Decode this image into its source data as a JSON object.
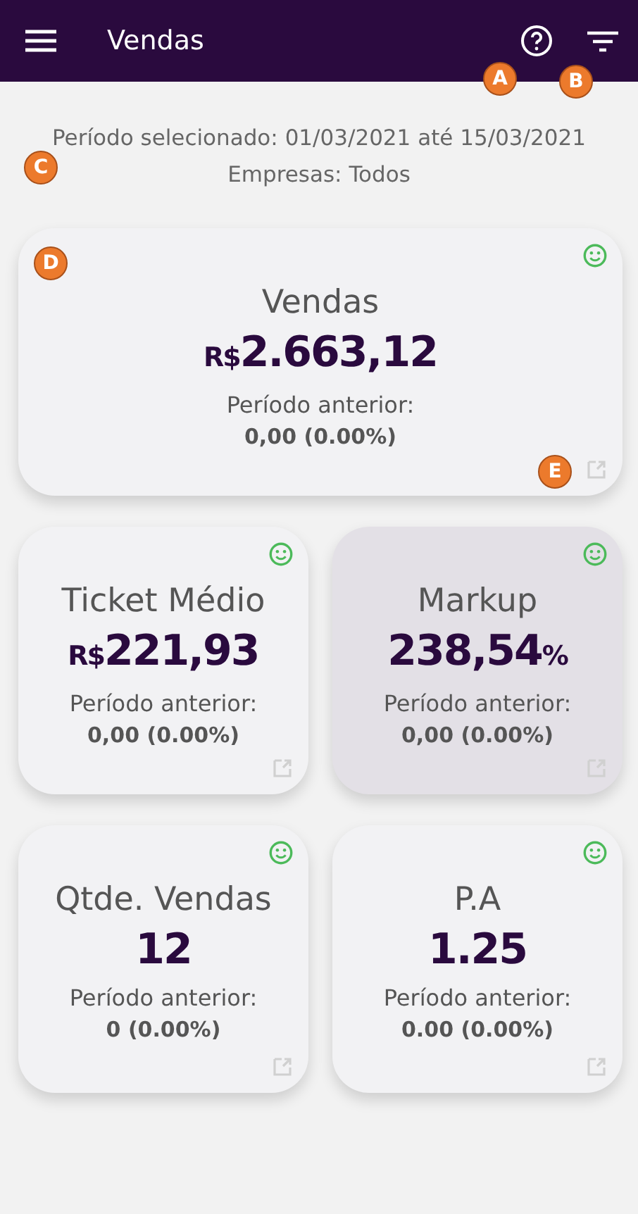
{
  "header": {
    "title": "Vendas",
    "help_callout": "A",
    "filter_callout": "B"
  },
  "period": {
    "text": "Período selecionado: 01/03/2021 até 15/03/2021",
    "companies": "Empresas: Todos",
    "callout": "C"
  },
  "featured_card": {
    "title": "Vendas",
    "prefix": "R$",
    "value": "2.663,12",
    "previous_label": "Período anterior:",
    "previous_value": "0,00 (0.00%)",
    "positive": true,
    "highlighted": false,
    "corner_callout": "D",
    "link_callout": "E"
  },
  "cards": [
    {
      "title": "Ticket Médio",
      "prefix": "R$",
      "value": "221,93",
      "previous_label": "Período anterior:",
      "previous_value": "0,00 (0.00%)",
      "positive": true,
      "highlighted": false
    },
    {
      "title": "Markup",
      "value": "238,54",
      "suffix": "%",
      "previous_label": "Período anterior:",
      "previous_value": "0,00 (0.00%)",
      "positive": true,
      "highlighted": true
    },
    {
      "title": "Qtde. Vendas",
      "value": "12",
      "previous_label": "Período anterior:",
      "previous_value": "0 (0.00%)",
      "positive": true,
      "highlighted": false
    },
    {
      "title": "P.A",
      "value": "1.25",
      "previous_label": "Período anterior:",
      "previous_value": "0.00 (0.00%)",
      "positive": true,
      "highlighted": false
    }
  ]
}
